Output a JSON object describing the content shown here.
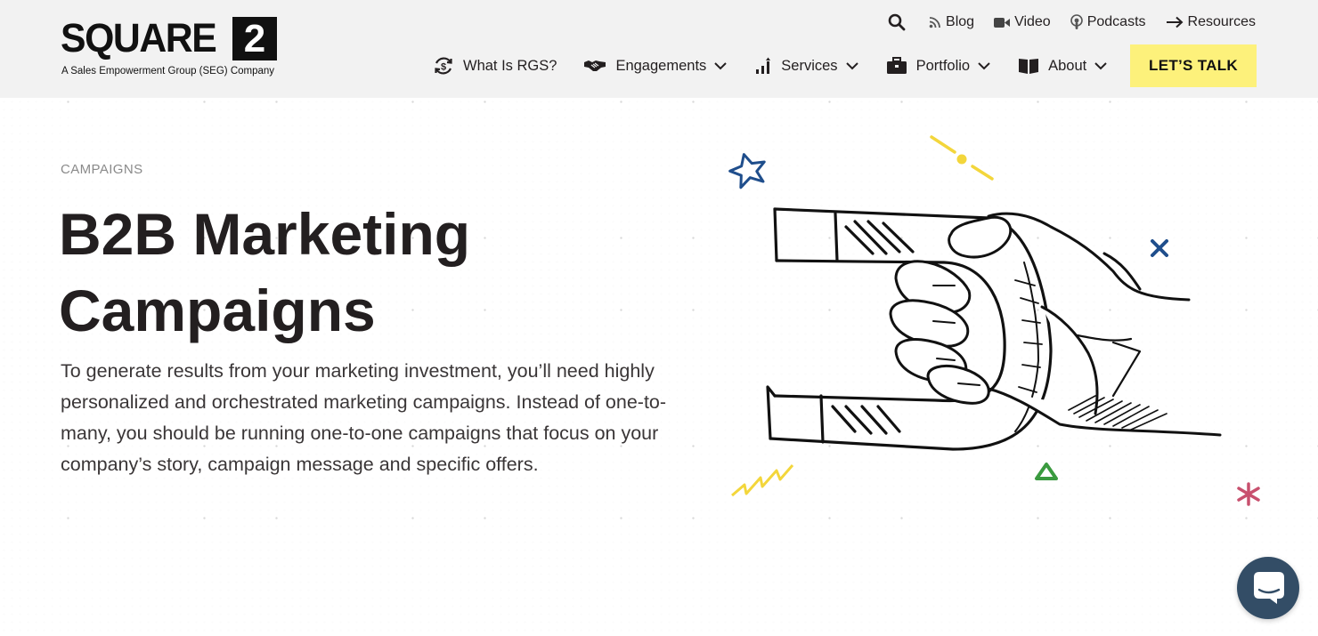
{
  "header": {
    "logo": {
      "wordmark": "SQUARE",
      "mark": "2",
      "tagline": "A Sales Empowerment Group (SEG) Company"
    },
    "utility_nav": [
      {
        "label": "Blog",
        "icon": "rss-icon"
      },
      {
        "label": "Video",
        "icon": "video-camera-icon"
      },
      {
        "label": "Podcasts",
        "icon": "podcast-icon"
      },
      {
        "label": "Resources",
        "icon": "arrow-right-icon"
      }
    ],
    "main_nav": [
      {
        "label": "What Is RGS?",
        "icon": "refresh-dollar-icon",
        "dropdown": false
      },
      {
        "label": "Engagements",
        "icon": "handshake-icon",
        "dropdown": true
      },
      {
        "label": "Services",
        "icon": "bar-chart-icon",
        "dropdown": true
      },
      {
        "label": "Portfolio",
        "icon": "briefcase-icon",
        "dropdown": true
      },
      {
        "label": "About",
        "icon": "book-icon",
        "dropdown": true
      }
    ],
    "cta_label": "LET’S TALK"
  },
  "hero": {
    "eyebrow": "CAMPAIGNS",
    "title_line1": "B2B Marketing",
    "title_line2": "Campaigns",
    "body": "To generate results from your marketing investment, you’ll need highly personalized and orchestrated marketing campaigns. Instead of one-to-many, you should be running one-to-one campaigns that focus on your company’s story, campaign message and specific offers."
  },
  "colors": {
    "header_bg": "#f2f2f2",
    "cta_bg": "#fdf17b",
    "text": "#231f20",
    "eyebrow": "#8a8a8a",
    "chat_bg": "#334d66",
    "accent_blue": "#1f4e8c",
    "accent_yellow": "#f3d63b",
    "accent_green": "#3a9a3f",
    "accent_pink": "#c8506e"
  },
  "chat": {
    "icon": "chat-bubble-icon"
  }
}
